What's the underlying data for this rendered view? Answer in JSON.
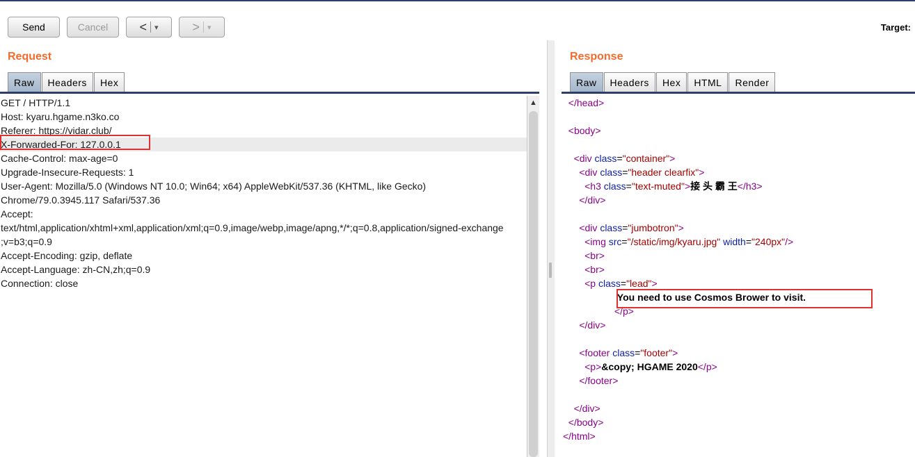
{
  "toolbar": {
    "send_label": "Send",
    "cancel_label": "Cancel",
    "back_label": "<",
    "forward_label": ">",
    "dropdown_glyph": "▾",
    "target_label": "Target:"
  },
  "request": {
    "title": "Request",
    "tabs": [
      "Raw",
      "Headers",
      "Hex"
    ],
    "active_tab": "Raw",
    "lines": [
      "GET / HTTP/1.1",
      "Host: kyaru.hgame.n3ko.co",
      "Referer: https://vidar.club/",
      "X-Forwarded-For: 127.0.0.1",
      "Cache-Control: max-age=0",
      "Upgrade-Insecure-Requests: 1",
      "User-Agent: Mozilla/5.0 (Windows NT 10.0; Win64; x64) AppleWebKit/537.36 (KHTML, like Gecko)",
      "Chrome/79.0.3945.117 Safari/537.36",
      "Accept:",
      "text/html,application/xhtml+xml,application/xml;q=0.9,image/webp,image/apng,*/*;q=0.8,application/signed-exchange",
      ";v=b3;q=0.9",
      "Accept-Encoding: gzip, deflate",
      "Accept-Language: zh-CN,zh;q=0.9",
      "Connection: close"
    ]
  },
  "response": {
    "title": "Response",
    "tabs": [
      "Raw",
      "Headers",
      "Hex",
      "HTML",
      "Render"
    ],
    "active_tab": "Raw",
    "lines": [
      [
        {
          "t": "  "
        },
        {
          "c": "t",
          "t": "</head>"
        }
      ],
      [],
      [
        {
          "t": "  "
        },
        {
          "c": "t",
          "t": "<body>"
        }
      ],
      [],
      [
        {
          "t": "    "
        },
        {
          "c": "t",
          "t": "<div "
        },
        {
          "c": "a",
          "t": "class"
        },
        {
          "t": "="
        },
        {
          "c": "v",
          "t": "\"container\""
        },
        {
          "c": "t",
          "t": ">"
        }
      ],
      [
        {
          "t": "      "
        },
        {
          "c": "t",
          "t": "<div "
        },
        {
          "c": "a",
          "t": "class"
        },
        {
          "t": "="
        },
        {
          "c": "v",
          "t": "\"header clearfix\""
        },
        {
          "c": "t",
          "t": ">"
        }
      ],
      [
        {
          "t": "        "
        },
        {
          "c": "t",
          "t": "<h3 "
        },
        {
          "c": "a",
          "t": "class"
        },
        {
          "t": "="
        },
        {
          "c": "v",
          "t": "\"text-muted\""
        },
        {
          "c": "t",
          "t": ">"
        },
        {
          "c": "b",
          "t": "接 头 霸 王"
        },
        {
          "c": "t",
          "t": "</h3>"
        }
      ],
      [
        {
          "t": "      "
        },
        {
          "c": "t",
          "t": "</div>"
        }
      ],
      [],
      [
        {
          "t": "      "
        },
        {
          "c": "t",
          "t": "<div "
        },
        {
          "c": "a",
          "t": "class"
        },
        {
          "t": "="
        },
        {
          "c": "v",
          "t": "\"jumbotron\""
        },
        {
          "c": "t",
          "t": ">"
        }
      ],
      [
        {
          "t": "        "
        },
        {
          "c": "t",
          "t": "<img "
        },
        {
          "c": "a",
          "t": "src"
        },
        {
          "t": "="
        },
        {
          "c": "v",
          "t": "\"/static/img/kyaru.jpg\""
        },
        {
          "t": " "
        },
        {
          "c": "a",
          "t": "width"
        },
        {
          "t": "="
        },
        {
          "c": "v",
          "t": "\"240px\""
        },
        {
          "c": "t",
          "t": "/>"
        }
      ],
      [
        {
          "t": "        "
        },
        {
          "c": "t",
          "t": "<br>"
        }
      ],
      [
        {
          "t": "        "
        },
        {
          "c": "t",
          "t": "<br>"
        }
      ],
      [
        {
          "t": "        "
        },
        {
          "c": "t",
          "t": "<p "
        },
        {
          "c": "a",
          "t": "class"
        },
        {
          "t": "="
        },
        {
          "c": "v",
          "t": "\"lead\""
        },
        {
          "c": "t",
          "t": ">"
        }
      ],
      [
        {
          "t": "                    "
        },
        {
          "c": "b",
          "t": "You need to use Cosmos Brower to visit."
        }
      ],
      [
        {
          "t": "                   "
        },
        {
          "c": "t",
          "t": "</p>"
        }
      ],
      [
        {
          "t": "      "
        },
        {
          "c": "t",
          "t": "</div>"
        }
      ],
      [],
      [
        {
          "t": "      "
        },
        {
          "c": "t",
          "t": "<footer "
        },
        {
          "c": "a",
          "t": "class"
        },
        {
          "t": "="
        },
        {
          "c": "v",
          "t": "\"footer\""
        },
        {
          "c": "t",
          "t": ">"
        }
      ],
      [
        {
          "t": "        "
        },
        {
          "c": "t",
          "t": "<p>"
        },
        {
          "c": "b",
          "t": "&copy; HGAME 2020"
        },
        {
          "c": "t",
          "t": "</p>"
        }
      ],
      [
        {
          "t": "      "
        },
        {
          "c": "t",
          "t": "</footer>"
        }
      ],
      [],
      [
        {
          "t": "    "
        },
        {
          "c": "t",
          "t": "</div>"
        }
      ],
      [
        {
          "t": "  "
        },
        {
          "c": "t",
          "t": "</body>"
        }
      ],
      [
        {
          "c": "t",
          "t": "</html>"
        }
      ]
    ]
  },
  "colors": {
    "title_orange": "#f26b2d",
    "highlight_red": "#e03030",
    "tag_purple": "#8b008b",
    "attr_blue": "#0b1ea8",
    "value_red": "#a30000"
  }
}
